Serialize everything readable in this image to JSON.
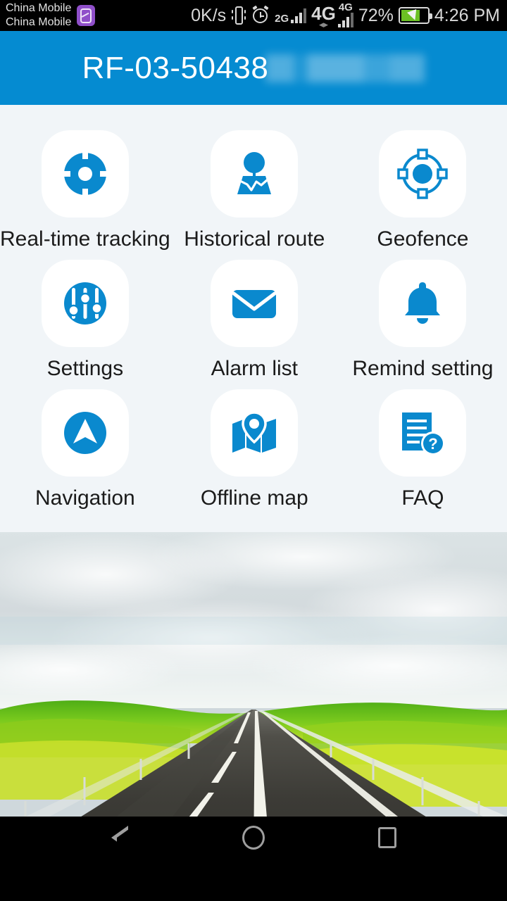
{
  "statusbar": {
    "carrier_line1": "China Mobile",
    "carrier_line2": "China Mobile",
    "sim_badge_icon": "sim-card-icon",
    "network_speed": "0K/s",
    "vibrate_icon": "vibrate-icon",
    "alarm_icon": "alarm-clock-icon",
    "signal1_label": "2G",
    "signal2_label": "4G",
    "signal2_small_label": "4G",
    "battery_percent": "72%",
    "battery_icon": "battery-charging-icon",
    "clock": "4:26 PM"
  },
  "header": {
    "title": "RF-03-50438",
    "redacted": true,
    "background_color": "#058bd1",
    "text_color": "#ffffff"
  },
  "main": {
    "background_color": "#f1f5f8",
    "accent_color": "#0a89ce",
    "tiles": [
      {
        "label": "Real-time tracking",
        "icon": "target-crosshair-icon"
      },
      {
        "label": "Historical route",
        "icon": "map-pin-route-icon"
      },
      {
        "label": "Geofence",
        "icon": "geofence-ring-icon"
      },
      {
        "label": "Settings",
        "icon": "sliders-icon"
      },
      {
        "label": "Alarm list",
        "icon": "envelope-icon"
      },
      {
        "label": "Remind setting",
        "icon": "bell-icon"
      },
      {
        "label": "Navigation",
        "icon": "navigation-arrow-icon"
      },
      {
        "label": "Offline map",
        "icon": "folded-map-pin-icon"
      },
      {
        "label": "FAQ",
        "icon": "document-question-icon"
      }
    ]
  },
  "photo": {
    "description": "countryside road photo",
    "sky_color": "#dfe5e6",
    "grass_color": "#5fbe17",
    "road_color": "#3b3a35"
  },
  "navbar": {
    "back_icon": "back-triangle-icon",
    "home_icon": "home-circle-icon",
    "recents_icon": "recents-square-icon"
  }
}
